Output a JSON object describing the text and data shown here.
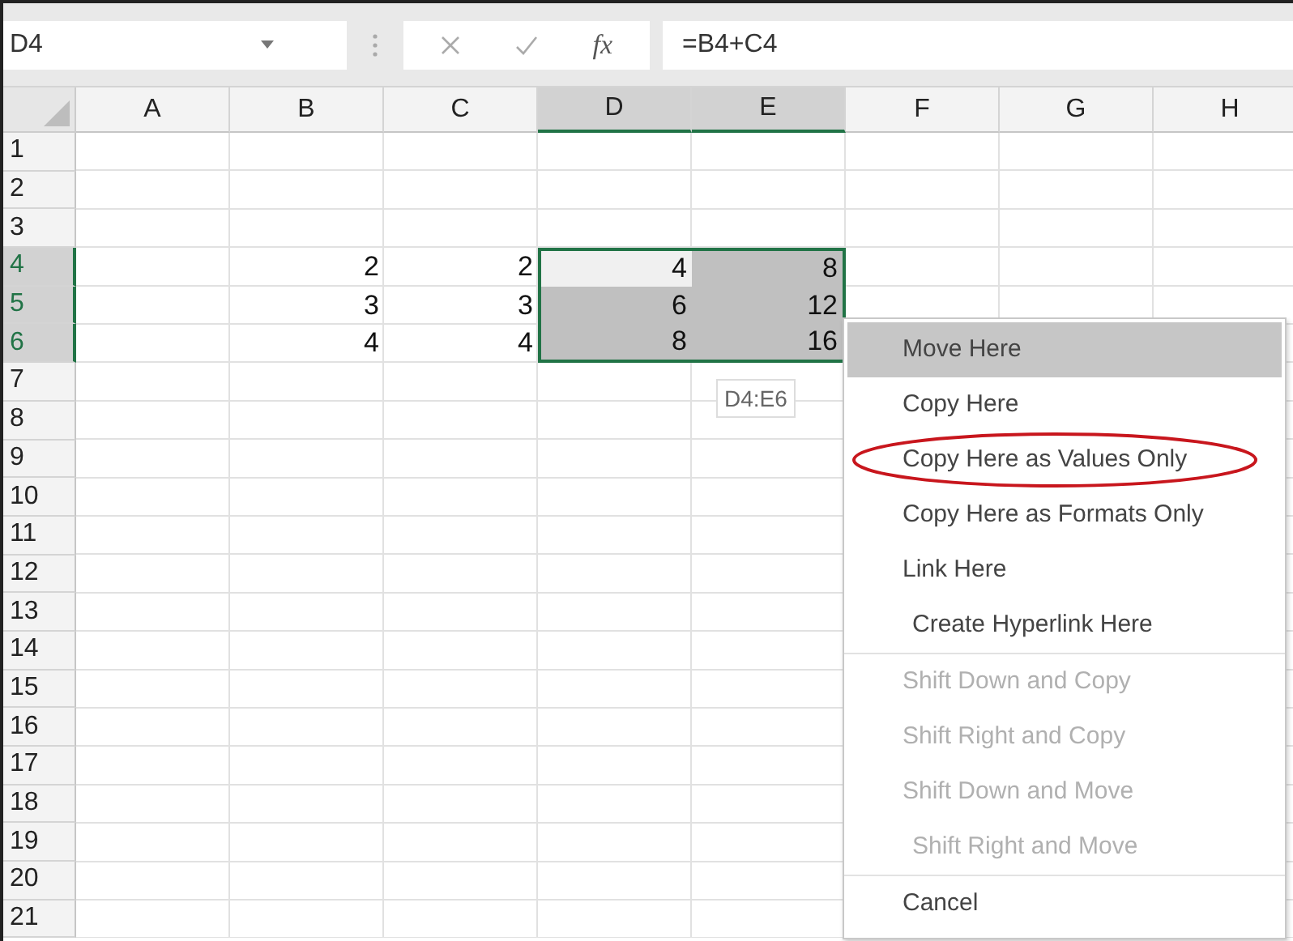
{
  "formula_bar": {
    "name_box": "D4",
    "function_label": "fx",
    "formula": "=B4+C4"
  },
  "columns": [
    {
      "label": "A",
      "selected": false
    },
    {
      "label": "B",
      "selected": false
    },
    {
      "label": "C",
      "selected": false
    },
    {
      "label": "D",
      "selected": true
    },
    {
      "label": "E",
      "selected": true
    },
    {
      "label": "F",
      "selected": false
    },
    {
      "label": "G",
      "selected": false
    },
    {
      "label": "H",
      "selected": false
    }
  ],
  "rows": [
    {
      "label": "1",
      "selected": false
    },
    {
      "label": "2",
      "selected": false
    },
    {
      "label": "3",
      "selected": false
    },
    {
      "label": "4",
      "selected": true,
      "cells": {
        "B": {
          "value": "2",
          "active": false
        },
        "C": {
          "value": "2",
          "active": false
        },
        "D": {
          "value": "4",
          "active": true
        },
        "E": {
          "value": "8",
          "active": false
        }
      }
    },
    {
      "label": "5",
      "selected": true,
      "cells": {
        "B": {
          "value": "3",
          "active": false
        },
        "C": {
          "value": "3",
          "active": false
        },
        "D": {
          "value": "6",
          "active": false
        },
        "E": {
          "value": "12",
          "active": false
        }
      }
    },
    {
      "label": "6",
      "selected": true,
      "cells": {
        "B": {
          "value": "4",
          "active": false
        },
        "C": {
          "value": "4",
          "active": false
        },
        "D": {
          "value": "8",
          "active": false
        },
        "E": {
          "value": "16",
          "active": false
        }
      }
    },
    {
      "label": "7",
      "selected": false
    },
    {
      "label": "8",
      "selected": false
    },
    {
      "label": "9",
      "selected": false
    },
    {
      "label": "10",
      "selected": false
    },
    {
      "label": "11",
      "selected": false
    },
    {
      "label": "12",
      "selected": false
    },
    {
      "label": "13",
      "selected": false
    },
    {
      "label": "14",
      "selected": false
    },
    {
      "label": "15",
      "selected": false
    },
    {
      "label": "16",
      "selected": false
    },
    {
      "label": "17",
      "selected": false
    },
    {
      "label": "18",
      "selected": false
    },
    {
      "label": "19",
      "selected": false
    },
    {
      "label": "20",
      "selected": false
    },
    {
      "label": "21",
      "selected": false
    }
  ],
  "drag_tooltip": "D4:E6",
  "context_menu": [
    {
      "label": "Move Here",
      "selected": true,
      "disabled": false,
      "circled": false,
      "separator_after": false
    },
    {
      "label": "Copy Here",
      "selected": false,
      "disabled": false,
      "circled": false,
      "separator_after": false
    },
    {
      "label": "Copy Here as Values Only",
      "selected": false,
      "disabled": false,
      "circled": true,
      "separator_after": false
    },
    {
      "label": "Copy Here as Formats Only",
      "selected": false,
      "disabled": false,
      "circled": false,
      "separator_after": false
    },
    {
      "label": "Link Here",
      "selected": false,
      "disabled": false,
      "circled": false,
      "separator_after": false
    },
    {
      "label": "Create Hyperlink Here",
      "selected": false,
      "disabled": false,
      "circled": false,
      "separator_after": true
    },
    {
      "label": "Shift Down and Copy",
      "selected": false,
      "disabled": true,
      "circled": false,
      "separator_after": false
    },
    {
      "label": "Shift Right and Copy",
      "selected": false,
      "disabled": true,
      "circled": false,
      "separator_after": false
    },
    {
      "label": "Shift Down and Move",
      "selected": false,
      "disabled": true,
      "circled": false,
      "separator_after": false
    },
    {
      "label": "Shift Right and Move",
      "selected": false,
      "disabled": true,
      "circled": false,
      "separator_after": true
    },
    {
      "label": "Cancel",
      "selected": false,
      "disabled": false,
      "circled": false,
      "separator_after": false
    }
  ]
}
